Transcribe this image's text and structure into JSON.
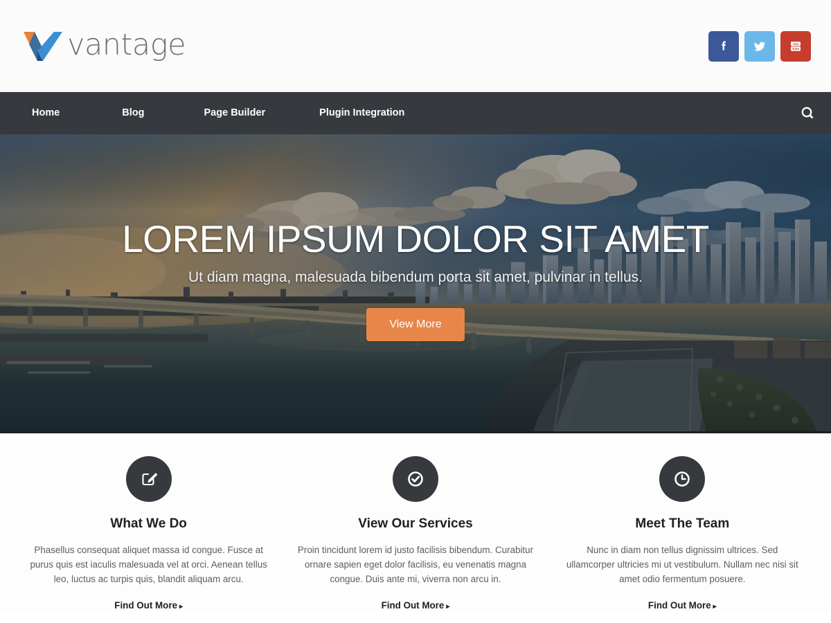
{
  "header": {
    "logo": {
      "mark_name": "vantage-logo-mark",
      "wordmark": "vantage",
      "color_orange": "#e8823c",
      "color_blue_light": "#3b8fd4",
      "color_blue_dark": "#2b6ca3",
      "wordmark_color": "#6d7378"
    },
    "social": [
      {
        "name": "facebook",
        "label": "f",
        "color": "#3b5998"
      },
      {
        "name": "twitter",
        "label": "Twitter",
        "color": "#6cb7ea"
      },
      {
        "name": "youtube",
        "label": "You Tube",
        "color": "#c63d2d"
      }
    ]
  },
  "nav": {
    "background": "#36393d",
    "items": [
      {
        "label": "Home"
      },
      {
        "label": "Blog"
      },
      {
        "label": "Page Builder"
      },
      {
        "label": "Plugin Integration"
      }
    ],
    "search_icon": "search-icon"
  },
  "hero": {
    "title": "LOREM IPSUM DOLOR SIT AMET",
    "subtitle": "Ut diam magna, malesuada bibendum porta sit amet, pulvinar in tellus.",
    "button_label": "View More",
    "button_color": "#e8864a",
    "image_description": "Aerial dusk photo of Miami skyline with causeway bridge over bay"
  },
  "features": [
    {
      "icon": "pencil-square-icon",
      "title": "What We Do",
      "text": "Phasellus consequat aliquet massa id congue. Fusce at purus quis est iaculis malesuada vel at orci. Aenean tellus leo, luctus ac turpis quis, blandit aliquam arcu.",
      "link_label": "Find Out More",
      "link_arrow": "▸"
    },
    {
      "icon": "check-circle-icon",
      "title": "View Our Services",
      "text": "Proin tincidunt lorem id justo facilisis bibendum. Curabitur ornare sapien eget dolor facilisis, eu venenatis magna congue. Duis ante mi, viverra non arcu in.",
      "link_label": "Find Out More",
      "link_arrow": "▸"
    },
    {
      "icon": "clock-icon",
      "title": "Meet The Team",
      "text": "Nunc in diam non tellus dignissim ultrices. Sed ullamcorper ultricies mi ut vestibulum. Nullam nec nisi sit amet odio fermentum posuere.",
      "link_label": "Find Out More",
      "link_arrow": "▸"
    }
  ]
}
